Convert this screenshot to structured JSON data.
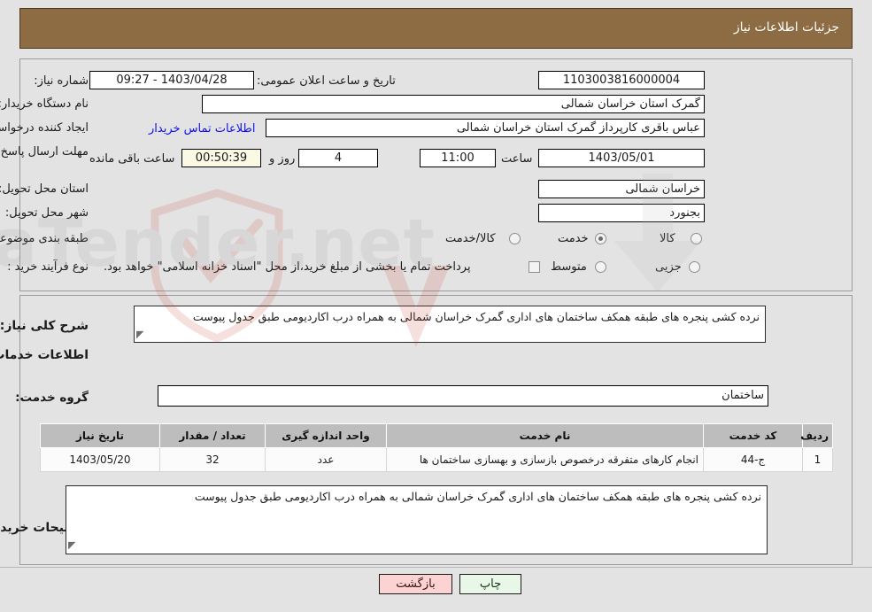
{
  "header": {
    "title": "جزئیات اطلاعات نیاز"
  },
  "form": {
    "need_number": {
      "label": "شماره نیاز:",
      "value": "1103003816000004"
    },
    "buyer_org": {
      "label": "نام دستگاه خریدار:",
      "value": "گمرک استان خراسان شمالی"
    },
    "requester": {
      "label": "ایجاد کننده درخواست:",
      "value": "عباس باقری کارپرداز گمرک استان خراسان شمالی"
    },
    "deadline": {
      "label": "مهلت ارسال پاسخ: تا تاریخ:",
      "value": "1403/05/01"
    },
    "deadline_hour_label": "ساعت",
    "deadline_hour_value": "11:00",
    "remaining_days": "4",
    "remaining_days_label": "روز و",
    "remaining_time": "00:50:39",
    "remaining_time_label": "ساعت باقی مانده",
    "announce": {
      "label": "تاریخ و ساعت اعلان عمومی:",
      "value": "1403/04/28 - 09:27"
    },
    "province": {
      "label": "استان محل تحویل:",
      "value": "خراسان شمالی"
    },
    "city": {
      "label": "شهر محل تحویل:",
      "value": "بجنورد"
    },
    "empty_field_value": "",
    "contact_link": "اطلاعات تماس خریدار",
    "classification": {
      "label": "طبقه بندی موضوعی:",
      "options": [
        {
          "label": "کالا",
          "selected": false
        },
        {
          "label": "خدمت",
          "selected": true
        },
        {
          "label": "کالا/خدمت",
          "selected": false
        }
      ]
    },
    "process_type": {
      "label": "نوع فرآیند خرید :",
      "options": [
        {
          "label": "جزیی",
          "selected": false
        },
        {
          "label": "متوسط",
          "selected": false
        }
      ]
    },
    "treasury_note": {
      "checked": false,
      "label": "پرداخت تمام یا بخشی از مبلغ خرید،از محل \"اسناد خزانه اسلامی\" خواهد بود."
    }
  },
  "need_summary": {
    "label": "شرح کلی نیاز:",
    "value": "نرده کشی پنجره های طبقه همکف ساختمان های اداری گمرک خراسان شمالی به همراه درب اکاردیومی طبق جدول پیوست"
  },
  "services_section": {
    "heading": "اطلاعات خدمات مورد نیاز",
    "service_group": {
      "label": "گروه خدمت:",
      "value": "ساختمان"
    },
    "table": {
      "columns": [
        "ردیف",
        "کد خدمت",
        "نام خدمت",
        "واحد اندازه گیری",
        "تعداد / مقدار",
        "تاریخ نیاز"
      ],
      "rows": [
        {
          "row_no": "1",
          "service_code": "ج-44",
          "service_name": "انجام کارهای متفرقه درخصوص بازسازی و بهسازی ساختمان ها",
          "unit": "عدد",
          "quantity": "32",
          "need_date": "1403/05/20"
        }
      ]
    }
  },
  "buyer_notes": {
    "label": "توضیحات خریدار:",
    "value": "نرده کشی پنجره های طبقه همکف ساختمان های اداری گمرک خراسان شمالی به همراه درب اکاردیومی  طبق جدول پیوست"
  },
  "buttons": {
    "print": "چاپ",
    "back": "بازگشت"
  },
  "watermark": {
    "text": "AriaTender.net"
  },
  "colors": {
    "header_bg": "#8d6b43",
    "link": "#1010e8",
    "back_button_bg": "#fbd3d3",
    "print_button_bg": "#e9f7e9",
    "countdown_bg": "#fbf8e3"
  }
}
